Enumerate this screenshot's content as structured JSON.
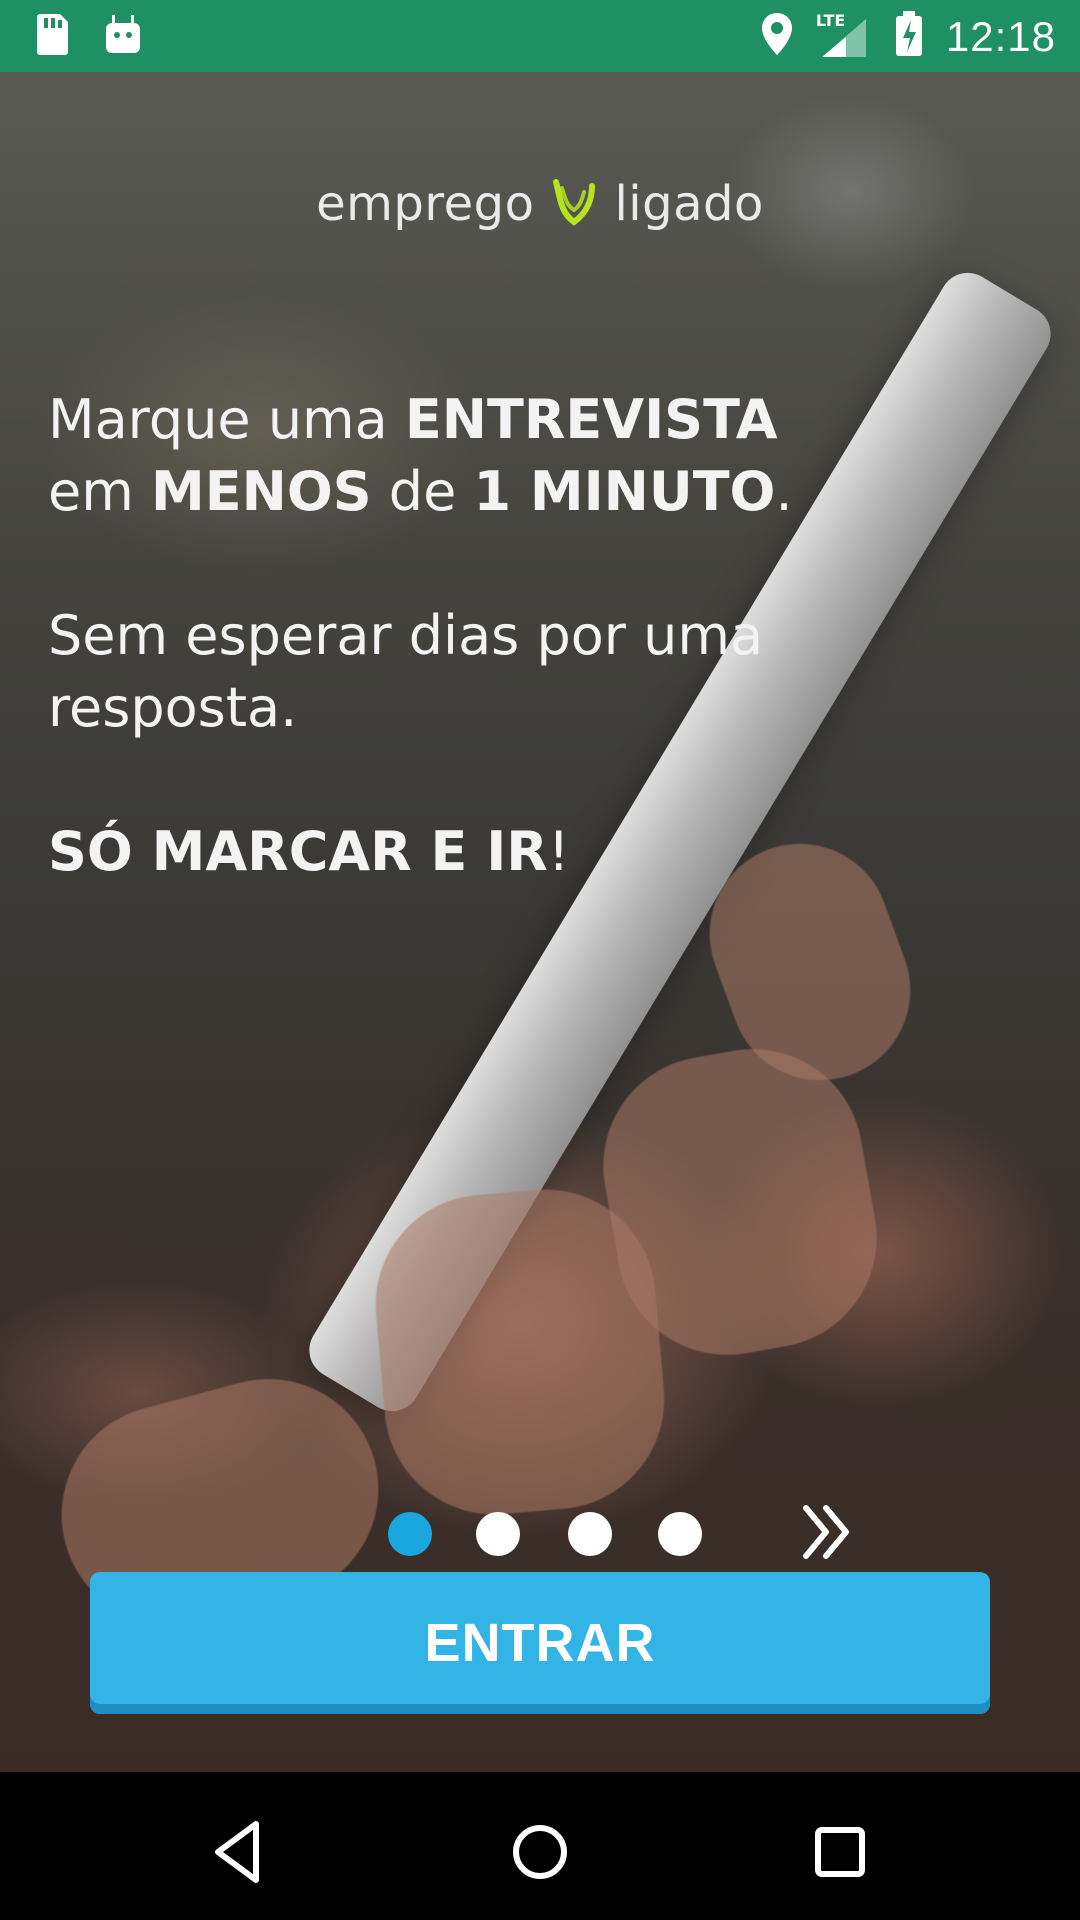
{
  "status_bar": {
    "left_icons": [
      "sd-card-icon",
      "android-debug-icon"
    ],
    "right_icons": [
      "location-icon",
      "lte-signal-icon",
      "battery-charging-icon"
    ],
    "lte_label": "LTE",
    "time": "12:18",
    "background_color": "#1e9064"
  },
  "logo": {
    "left_word": "emprego",
    "right_word": "ligado",
    "mark_icon": "emprego-ligado-logo-mark-icon",
    "mark_color": "#b7e321"
  },
  "copy": {
    "p1": {
      "l1_pre": "Marque uma ",
      "l1_bold": "ENTREVISTA",
      "l2_pre": "em ",
      "l2_bold1": "MENOS",
      "l2_mid": " de ",
      "l2_bold2": "1 MINUTO",
      "l2_post": "."
    },
    "p2": {
      "l1": "Sem esperar dias por uma",
      "l2": "resposta."
    },
    "p3": {
      "bold": "SÓ MARCAR E IR",
      "post": "!"
    }
  },
  "pager": {
    "total_pages": 4,
    "current_page": 1,
    "next_icon": "double-chevron-right-icon",
    "active_color": "#1aa7df"
  },
  "cta": {
    "label": "ENTRAR",
    "color": "#33b4e6"
  },
  "nav_bar": {
    "items": [
      "back-triangle-icon",
      "home-circle-icon",
      "recents-square-icon"
    ]
  }
}
